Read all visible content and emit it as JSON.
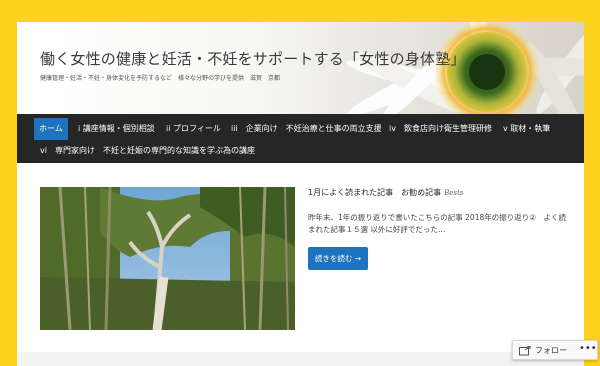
{
  "header": {
    "site_title": "働く女性の健康と妊活・不妊をサポートする「女性の身体塾」",
    "site_description": "健康管理・妊活・不妊・身体変化を予防するなど　様々な分野の学びを提供　滋賀　京都"
  },
  "nav": {
    "items": [
      {
        "label": "ホーム",
        "active": true
      },
      {
        "label": "i 講座情報・個別相談"
      },
      {
        "label": "ii プロフィール"
      },
      {
        "label": "iii　企業向け　不妊治療と仕事の両立支援"
      },
      {
        "label": "iv　飲食店向け衛生管理研修"
      },
      {
        "label": "v 取材・執筆"
      },
      {
        "label": "vi　専門家向け　不妊と妊娠の専門的な知識を学ぶ為の講座"
      }
    ]
  },
  "post": {
    "title": "1月によく読まれた記事　お勧め記事",
    "title_sub": "Bests",
    "excerpt": "昨年末、1年の振り返りで書いたこちらの記事 2018年の振り返り②　よく読まれた記事１５選 以外に好評でだった…",
    "more_label": "続きを読む →"
  },
  "follow": {
    "label": "フォロー",
    "more": "•••"
  },
  "colors": {
    "background": "#ffd21f",
    "nav_bg": "#262626",
    "accent": "#1e73be"
  }
}
